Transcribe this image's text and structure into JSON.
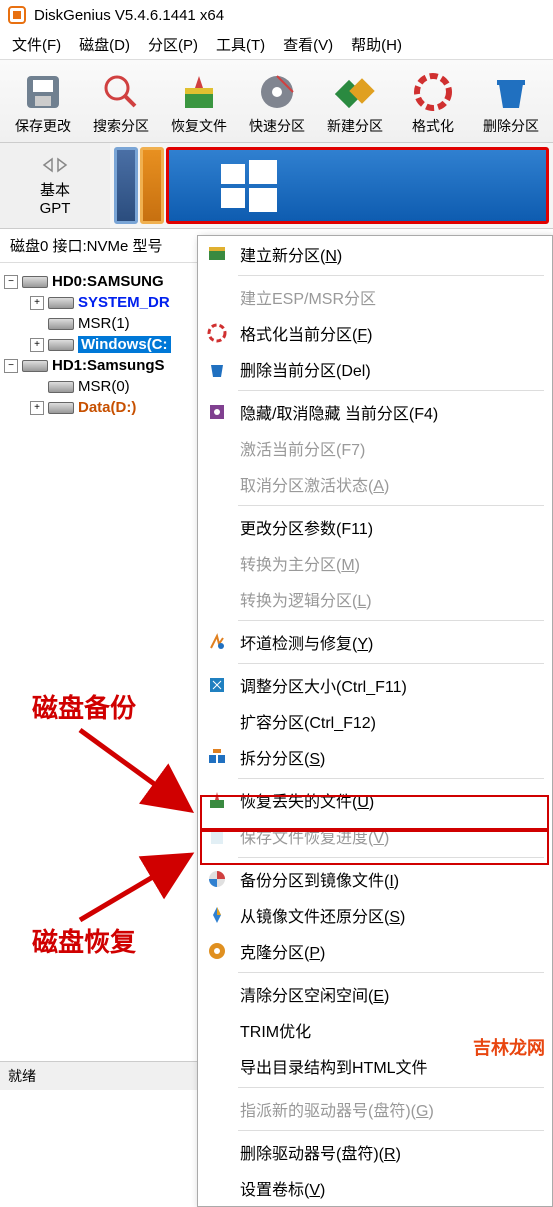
{
  "title": "DiskGenius V5.4.6.1441 x64",
  "menu": [
    "文件(F)",
    "磁盘(D)",
    "分区(P)",
    "工具(T)",
    "查看(V)",
    "帮助(H)"
  ],
  "toolbar": [
    "保存更改",
    "搜索分区",
    "恢复文件",
    "快速分区",
    "新建分区",
    "格式化",
    "删除分区"
  ],
  "disk_info": {
    "type": "基本",
    "scheme": "GPT"
  },
  "status_line": "磁盘0 接口:NVMe  型号",
  "tree": {
    "hd0": "HD0:SAMSUNG",
    "hd0_items": [
      "SYSTEM_DR",
      "MSR(1)",
      "Windows(C:"
    ],
    "hd1": "HD1:SamsungS",
    "hd1_items": [
      "MSR(0)",
      "Data(D:)"
    ]
  },
  "ctx": [
    {
      "t": "建立新分区(N)",
      "d": false,
      "u": "N"
    },
    {
      "t": "建立ESP/MSR分区",
      "d": true
    },
    {
      "t": "格式化当前分区(F)",
      "d": false,
      "u": "F"
    },
    {
      "t": "删除当前分区(Del)",
      "d": false
    },
    {
      "t": "隐藏/取消隐藏 当前分区(F4)",
      "d": false
    },
    {
      "t": "激活当前分区(F7)",
      "d": true
    },
    {
      "t": "取消分区激活状态(A)",
      "d": true,
      "u": "A"
    },
    {
      "t": "更改分区参数(F11)",
      "d": false
    },
    {
      "t": "转换为主分区(M)",
      "d": true,
      "u": "M"
    },
    {
      "t": "转换为逻辑分区(L)",
      "d": true,
      "u": "L"
    },
    {
      "t": "坏道检测与修复(Y)",
      "d": false,
      "u": "Y"
    },
    {
      "t": "调整分区大小(Ctrl_F11)",
      "d": false
    },
    {
      "t": "扩容分区(Ctrl_F12)",
      "d": false
    },
    {
      "t": "拆分分区(S)",
      "d": false,
      "u": "S"
    },
    {
      "t": "恢复丢失的文件(U)",
      "d": false,
      "u": "U"
    },
    {
      "t": "保存文件恢复进度(V)",
      "d": true,
      "u": "V"
    },
    {
      "t": "备份分区到镜像文件(I)",
      "d": false,
      "u": "I"
    },
    {
      "t": "从镜像文件还原分区(S)",
      "d": false,
      "u": "S"
    },
    {
      "t": "克隆分区(P)",
      "d": false,
      "u": "P"
    },
    {
      "t": "清除分区空闲空间(E)",
      "d": false,
      "u": "E"
    },
    {
      "t": "TRIM优化",
      "d": false
    },
    {
      "t": "导出目录结构到HTML文件",
      "d": false
    },
    {
      "t": "指派新的驱动器号(盘符)(G)",
      "d": true,
      "u": "G"
    },
    {
      "t": "删除驱动器号(盘符)(R)",
      "d": false,
      "u": "R"
    },
    {
      "t": "设置卷标(V)",
      "d": false,
      "u": "V"
    }
  ],
  "annotations": {
    "backup": "磁盘备份",
    "restore": "磁盘恢复"
  },
  "status_bar": "就绪",
  "watermark": "吉林龙网"
}
